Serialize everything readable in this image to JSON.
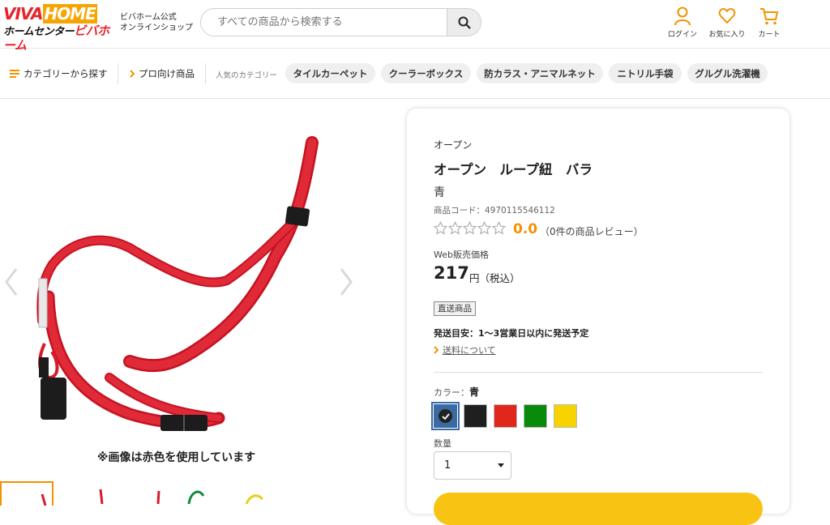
{
  "header": {
    "logo_top_a": "VIVA",
    "logo_top_b": "HOME",
    "logo_bottom_a": "ホームセンター",
    "logo_bottom_b": "ビバホーム",
    "official_line1": "ビバホーム公式",
    "official_line2": "オンラインショップ",
    "search_placeholder": "すべての商品から検索する",
    "login_label": "ログイン",
    "favorites_label": "お気に入り",
    "cart_label": "カート",
    "accent_color": "#f29200"
  },
  "nav": {
    "categories_label": "カテゴリーから探す",
    "pro_label": "プロ向け商品",
    "popular_label": "人気のカテゴリー",
    "chips": [
      "タイルカーペット",
      "クーラーボックス",
      "防カラス・アニマルネット",
      "ニトリル手袋",
      "グルグル洗濯機"
    ]
  },
  "gallery": {
    "caption": "※画像は赤色を使用しています",
    "product_color": "#d9182a"
  },
  "product": {
    "brand": "オープン",
    "title": "オープン　ループ紐　バラ",
    "variant": "青",
    "code": "商品コード：4970115546112",
    "rating": "0.0",
    "review_count": "（0件の商品レビュー）",
    "price_label": "Web販売価格",
    "price": "217",
    "price_unit": "円（税込）",
    "direct_badge": "直送商品",
    "shipping_estimate": "発送目安：1〜3営業日以内に発送予定",
    "shipping_link": "送料について",
    "color_label": "カラー：",
    "color_selected": "青",
    "swatches": [
      "#3b6aa3",
      "#1f1f1f",
      "#e1261c",
      "#0a8a0a",
      "#f7d400"
    ],
    "quantity_label": "数量",
    "quantity_value": "1",
    "cart_button_color": "#f9c313"
  }
}
